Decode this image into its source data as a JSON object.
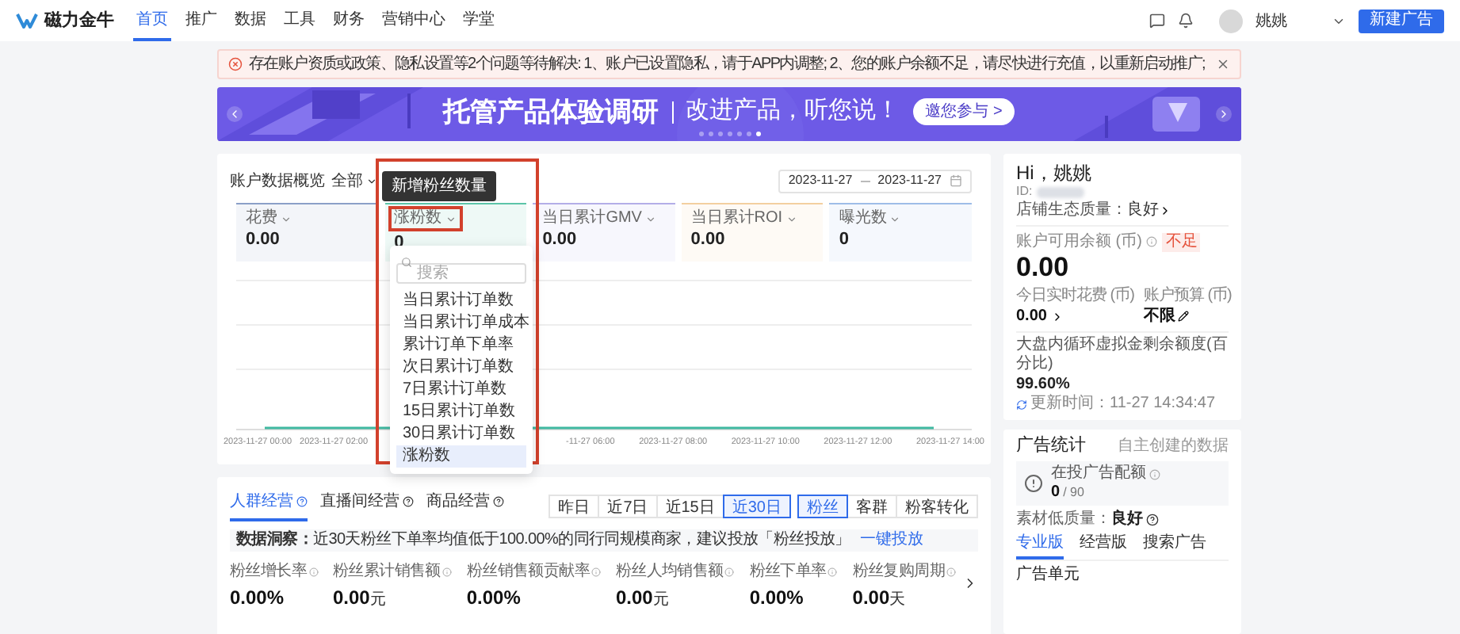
{
  "nav": {
    "logo": "磁力金牛",
    "items": [
      {
        "label": "首页",
        "selected": true
      },
      {
        "label": "推广",
        "selected": false
      },
      {
        "label": "数据",
        "selected": false
      },
      {
        "label": "工具",
        "selected": false
      },
      {
        "label": "财务",
        "selected": false
      },
      {
        "label": "营销中心",
        "selected": false
      },
      {
        "label": "学堂",
        "selected": false
      }
    ],
    "user_name": "姚姚",
    "create_button": "新建广告"
  },
  "alert": {
    "text": "存在账户资质或政策、隐私设置等2个问题等待解决: 1、账户已设置隐私，请于APP内调整; 2、您的账户余额不足，请尽快进行充值，以重新启动推广;"
  },
  "banner": {
    "title": "托管产品体验调研",
    "subtitle": "改进产品，听您说！",
    "button": "邀您参与 >",
    "dots": [
      {
        "selected": false
      },
      {
        "selected": false
      },
      {
        "selected": false
      },
      {
        "selected": false
      },
      {
        "selected": false
      },
      {
        "selected": false
      },
      {
        "selected": true
      }
    ]
  },
  "overview": {
    "title": "账户数据概览",
    "filter": "全部",
    "date_start": "2023-11-27",
    "date_end": "2023-11-27",
    "metrics": [
      {
        "label": "花费",
        "value": "0.00",
        "color": "#8ba0c8"
      },
      {
        "label": "涨粉数",
        "value": "0",
        "color": "#5cc4a8"
      },
      {
        "label": "当日累计GMV",
        "value": "0.00",
        "color": "#b3aee8"
      },
      {
        "label": "当日累计ROI",
        "value": "0.00",
        "color": "#f3cfa0"
      },
      {
        "label": "曝光数",
        "value": "0",
        "color": "#9ebde8"
      }
    ],
    "x_labels": [
      "2023-11-27 00:00",
      "2023-11-27 02:00",
      "-11-27 06:00",
      "2023-11-27 08:00",
      "2023-11-27 10:00",
      "2023-11-27 12:00",
      "2023-11-27 14:00"
    ],
    "tooltip": "新增粉丝数量",
    "dropdown": {
      "placeholder": "搜索",
      "options": [
        {
          "label": "当日累计订单数",
          "selected": false
        },
        {
          "label": "当日累计订单成本",
          "selected": false
        },
        {
          "label": "累计订单下单率",
          "selected": false
        },
        {
          "label": "次日累计订单数",
          "selected": false
        },
        {
          "label": "7日累计订单数",
          "selected": false
        },
        {
          "label": "15日累计订单数",
          "selected": false
        },
        {
          "label": "30日累计订单数",
          "selected": false
        },
        {
          "label": "涨粉数",
          "selected": true
        }
      ]
    }
  },
  "account": {
    "greeting": "Hi，姚姚",
    "id_label": "ID:",
    "quality_label": "店铺生态质量：",
    "quality_value": "良好",
    "balance_label": "账户可用余额 (币)",
    "balance_tag": "不足",
    "balance": "0.00",
    "spend_label": "今日实时花费 (币)",
    "spend": "0.00",
    "budget_label": "账户预算 (币)",
    "budget": "不限",
    "ratio_label": "大盘内循环虚拟金剩余额度(百分比)",
    "ratio": "99.60%",
    "updated": "更新时间：11-27 14:34:47"
  },
  "ad_stats": {
    "title": "广告统计",
    "note": "自主创建的数据",
    "quota_label": "在投广告配额",
    "quota_value": "0",
    "quota_total": "/ 90",
    "material_label": "素材低质量：",
    "material_value": "良好",
    "tabs": [
      {
        "label": "专业版",
        "selected": true
      },
      {
        "label": "经营版",
        "selected": false
      },
      {
        "label": "搜索广告",
        "selected": false
      }
    ],
    "section": "广告单元"
  },
  "operations": {
    "tabs": [
      {
        "label": "人群经营",
        "selected": true
      },
      {
        "label": "直播间经营",
        "selected": false
      },
      {
        "label": "商品经营",
        "selected": false
      }
    ],
    "ranges": [
      {
        "label": "昨日",
        "selected": false
      },
      {
        "label": "近7日",
        "selected": false
      },
      {
        "label": "近15日",
        "selected": false
      },
      {
        "label": "近30日",
        "selected": true
      }
    ],
    "views": [
      {
        "label": "粉丝",
        "selected": true
      },
      {
        "label": "客群",
        "selected": false
      },
      {
        "label": "粉客转化",
        "selected": false
      }
    ],
    "insight": "**数据洞察：**近30天粉丝下单率均值低于100.00%的同行同规模商家，建议投放「粉丝投放」",
    "insight_link": "一键投放",
    "metrics": [
      {
        "label": "粉丝增长率",
        "value": "0.00%"
      },
      {
        "label": "粉丝累计销售额",
        "value": "0.00",
        "unit": "元"
      },
      {
        "label": "粉丝销售额贡献率",
        "value": "0.00%"
      },
      {
        "label": "粉丝人均销售额",
        "value": "0.00",
        "unit": "元"
      },
      {
        "label": "粉丝下单率",
        "value": "0.00%"
      },
      {
        "label": "粉丝复购周期",
        "value": "0.00",
        "unit": "天"
      }
    ]
  }
}
